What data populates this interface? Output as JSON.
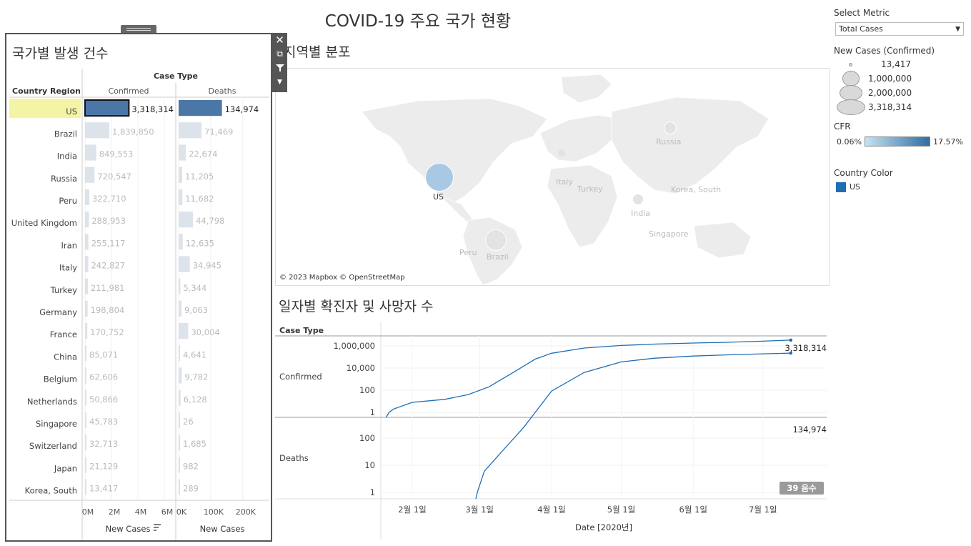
{
  "page": {
    "title": "COVID-19 주요 국가 현황"
  },
  "right_panel": {
    "select_metric_label": "Select Metric",
    "select_metric_value": "Total Cases",
    "size_legend_title": "New Cases (Confirmed)",
    "size_legend": [
      "13,417",
      "1,000,000",
      "2,000,000",
      "3,318,314"
    ],
    "cfr_title": "CFR",
    "cfr_min": "0.06%",
    "cfr_max": "17.57%",
    "country_color_title": "Country Color",
    "country_color_item": "US",
    "colors": {
      "us": "#1f6eb5",
      "bar_selected": "#4a77a8",
      "bar_other": "#dde3ea",
      "line": "#1f6eb5"
    }
  },
  "country_panel": {
    "title": "국가별 발생 건수",
    "case_type_header": "Case Type",
    "row_header": "Country Region",
    "col_confirmed": "Confirmed",
    "col_deaths": "Deaths",
    "axis_confirmed_ticks": [
      "0M",
      "2M",
      "4M",
      "6M"
    ],
    "axis_deaths_ticks": [
      "0K",
      "100K",
      "200K"
    ],
    "axis_label_confirmed": "New Cases",
    "axis_label_deaths": "New Cases",
    "rows": [
      {
        "country": "US",
        "confirmed": 3318314,
        "confirmed_label": "3,318,314",
        "deaths": 134974,
        "deaths_label": "134,974"
      },
      {
        "country": "Brazil",
        "confirmed": 1839850,
        "confirmed_label": "1,839,850",
        "deaths": 71469,
        "deaths_label": "71,469"
      },
      {
        "country": "India",
        "confirmed": 849553,
        "confirmed_label": "849,553",
        "deaths": 22674,
        "deaths_label": "22,674"
      },
      {
        "country": "Russia",
        "confirmed": 720547,
        "confirmed_label": "720,547",
        "deaths": 11205,
        "deaths_label": "11,205"
      },
      {
        "country": "Peru",
        "confirmed": 322710,
        "confirmed_label": "322,710",
        "deaths": 11682,
        "deaths_label": "11,682"
      },
      {
        "country": "United Kingdom",
        "confirmed": 288953,
        "confirmed_label": "288,953",
        "deaths": 44798,
        "deaths_label": "44,798"
      },
      {
        "country": "Iran",
        "confirmed": 255117,
        "confirmed_label": "255,117",
        "deaths": 12635,
        "deaths_label": "12,635"
      },
      {
        "country": "Italy",
        "confirmed": 242827,
        "confirmed_label": "242,827",
        "deaths": 34945,
        "deaths_label": "34,945"
      },
      {
        "country": "Turkey",
        "confirmed": 211981,
        "confirmed_label": "211,981",
        "deaths": 5344,
        "deaths_label": "5,344"
      },
      {
        "country": "Germany",
        "confirmed": 198804,
        "confirmed_label": "198,804",
        "deaths": 9063,
        "deaths_label": "9,063"
      },
      {
        "country": "France",
        "confirmed": 170752,
        "confirmed_label": "170,752",
        "deaths": 30004,
        "deaths_label": "30,004"
      },
      {
        "country": "China",
        "confirmed": 85071,
        "confirmed_label": "85,071",
        "deaths": 4641,
        "deaths_label": "4,641"
      },
      {
        "country": "Belgium",
        "confirmed": 62606,
        "confirmed_label": "62,606",
        "deaths": 9782,
        "deaths_label": "9,782"
      },
      {
        "country": "Netherlands",
        "confirmed": 50866,
        "confirmed_label": "50,866",
        "deaths": 6128,
        "deaths_label": "6,128"
      },
      {
        "country": "Singapore",
        "confirmed": 45783,
        "confirmed_label": "45,783",
        "deaths": 26,
        "deaths_label": "26"
      },
      {
        "country": "Switzerland",
        "confirmed": 32713,
        "confirmed_label": "32,713",
        "deaths": 1685,
        "deaths_label": "1,685"
      },
      {
        "country": "Japan",
        "confirmed": 21129,
        "confirmed_label": "21,129",
        "deaths": 982,
        "deaths_label": "982"
      },
      {
        "country": "Korea, South",
        "confirmed": 13417,
        "confirmed_label": "13,417",
        "deaths": 289,
        "deaths_label": "289"
      }
    ]
  },
  "map_section": {
    "title": "지역별 분포",
    "attribution": "© 2023 Mapbox © OpenStreetMap",
    "labels": [
      "US",
      "Russia",
      "Italy",
      "Turkey",
      "Korea, South",
      "India",
      "Singapore",
      "Peru",
      "Brazil"
    ]
  },
  "daily_section": {
    "title": "일자별 확진자 및 사망자 수",
    "case_type_header": "Case Type",
    "row_confirmed": "Confirmed",
    "row_deaths": "Deaths",
    "confirmed_ticks": [
      "1,000,000",
      "10,000",
      "100",
      "1"
    ],
    "deaths_ticks": [
      "100",
      "10",
      "1"
    ],
    "x_ticks": [
      "2월 1일",
      "3월 1일",
      "4월 1일",
      "5월 1일",
      "6월 1일",
      "7월 1일"
    ],
    "x_axis_label": "Date [2020년]",
    "confirmed_end_label": "3,318,314",
    "deaths_end_label": "134,974",
    "badge": "39 음수"
  },
  "chart_data": [
    {
      "type": "bar",
      "categories": [
        "US",
        "Brazil",
        "India",
        "Russia",
        "Peru",
        "United Kingdom",
        "Iran",
        "Italy",
        "Turkey",
        "Germany",
        "France",
        "China",
        "Belgium",
        "Netherlands",
        "Singapore",
        "Switzerland",
        "Japan",
        "Korea, South"
      ],
      "series": [
        {
          "name": "Confirmed",
          "values": [
            3318314,
            1839850,
            849553,
            720547,
            322710,
            288953,
            255117,
            242827,
            211981,
            198804,
            170752,
            85071,
            62606,
            50866,
            45783,
            32713,
            21129,
            13417
          ]
        },
        {
          "name": "Deaths",
          "values": [
            134974,
            71469,
            22674,
            11205,
            11682,
            44798,
            12635,
            34945,
            5344,
            9063,
            30004,
            4641,
            9782,
            6128,
            26,
            1685,
            982,
            289
          ]
        }
      ],
      "title": "국가별 발생 건수",
      "xlabel": "New Cases",
      "ylabel": "Country Region",
      "xlim_confirmed": [
        0,
        6800000
      ],
      "xlim_deaths": [
        0,
        280000
      ]
    },
    {
      "type": "line",
      "title": "일자별 확진자 및 사망자 수",
      "xlabel": "Date [2020년]",
      "log_scale": true,
      "series": [
        {
          "name": "Confirmed",
          "x": [
            "2020-01-22",
            "2020-01-24",
            "2020-02-01",
            "2020-02-15",
            "2020-02-25",
            "2020-03-05",
            "2020-03-15",
            "2020-03-25",
            "2020-04-01",
            "2020-04-15",
            "2020-05-01",
            "2020-05-15",
            "2020-06-01",
            "2020-06-15",
            "2020-07-01",
            "2020-07-13"
          ],
          "values": [
            1,
            2,
            8,
            15,
            40,
            200,
            3500,
            65000,
            215000,
            640000,
            1100000,
            1460000,
            1800000,
            2100000,
            2650000,
            3318314
          ]
        },
        {
          "name": "Deaths",
          "x": [
            "2020-02-29",
            "2020-03-03",
            "2020-03-10",
            "2020-03-20",
            "2020-04-01",
            "2020-04-15",
            "2020-05-01",
            "2020-05-15",
            "2020-06-01",
            "2020-06-15",
            "2020-07-01",
            "2020-07-13"
          ],
          "values": [
            1,
            6,
            28,
            250,
            5400,
            26000,
            64000,
            87000,
            105000,
            116000,
            127000,
            134974
          ]
        }
      ]
    }
  ]
}
